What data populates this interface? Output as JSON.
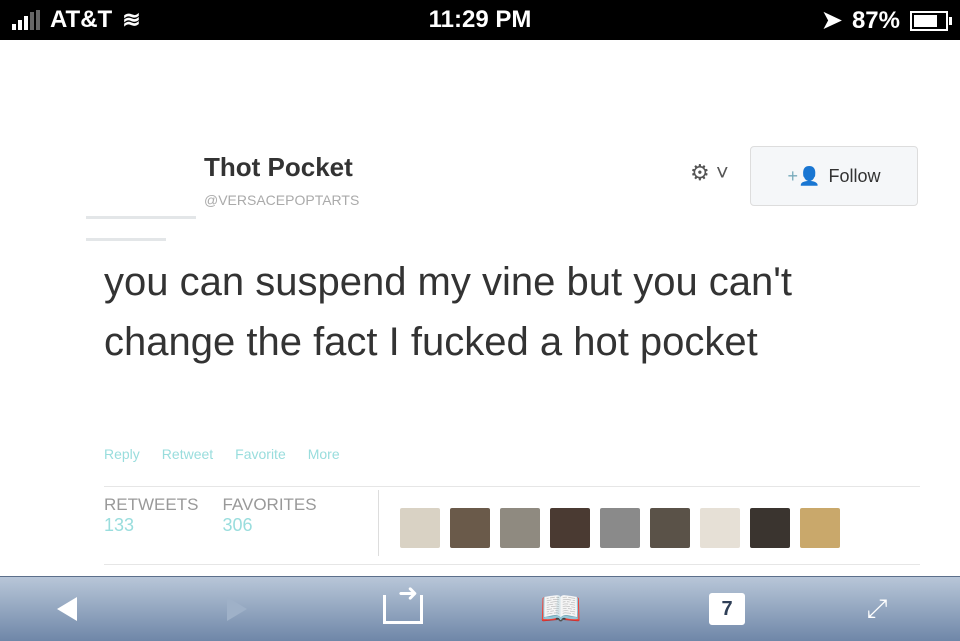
{
  "status_bar": {
    "carrier": "AT&T",
    "time": "11:29 PM",
    "battery": "87%",
    "battery_level": 0.87
  },
  "tweet": {
    "name": "Thot Pocket",
    "handle": "@VERSACEPOPTARTS",
    "follow_label": "Follow",
    "text": "you can suspend my vine but you can't change the fact I fucked a hot pocket",
    "actions": [
      "Reply",
      "Retweet",
      "Favorite",
      "More"
    ],
    "retweets_label": "RETWEETS",
    "retweets_count": "133",
    "favorites_label": "FAVORITES",
    "favorites_count": "306"
  },
  "avatars": {
    "colors": [
      "#d9d2c4",
      "#6a5a4a",
      "#8f8a80",
      "#4a3a32",
      "#8a8a8a",
      "#5a5248",
      "#e6e0d6",
      "#3a342f",
      "#c9a86b"
    ]
  },
  "toolbar": {
    "tabs_count": "7"
  }
}
